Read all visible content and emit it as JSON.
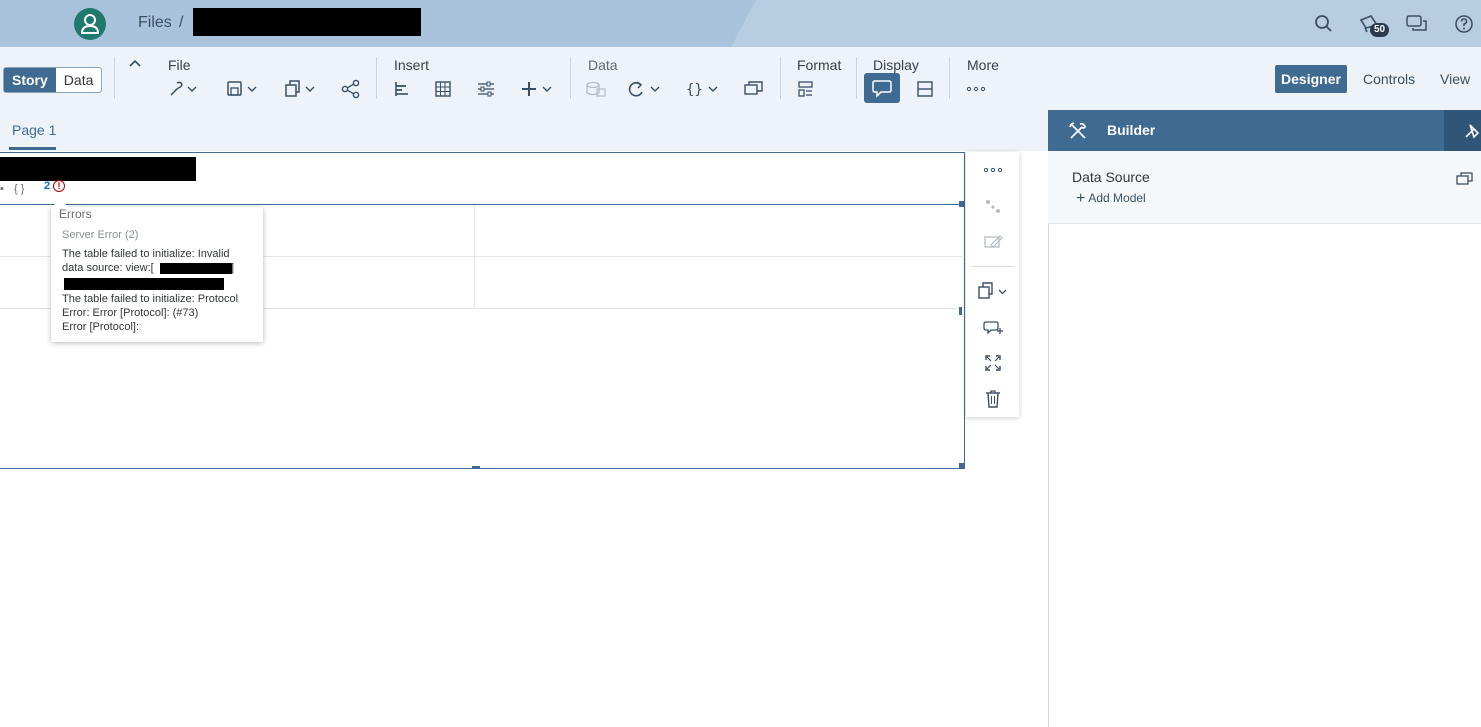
{
  "shell": {
    "breadcrumb_root": "Files",
    "breadcrumb_separator": "/",
    "notification_count": "50",
    "icons": [
      "menu-icon",
      "avatar-icon",
      "search-icon",
      "notifications-icon",
      "feedback-icon",
      "help-icon"
    ]
  },
  "toolbar": {
    "mode_tabs": {
      "story": "Story",
      "data": "Data"
    },
    "groups": {
      "file": "File",
      "insert": "Insert",
      "data": "Data",
      "format": "Format",
      "display": "Display",
      "more": "More"
    },
    "view_modes": {
      "designer": "Designer",
      "controls": "Controls",
      "view": "View"
    }
  },
  "page_tabs": {
    "page1": "Page 1"
  },
  "widget": {
    "curly_label": "{ }",
    "error_count": "2",
    "error_glyph": "!"
  },
  "error_popover": {
    "title": "Errors",
    "subtitle": "Server Error (2)",
    "line1": "The table failed to initialize: Invalid",
    "line2_prefix": "data source: view:[",
    "line2_suffix": "]",
    "line4": "The table failed to initialize: Protocol",
    "line5": "Error: Error [Protocol]: (#73)",
    "line6": "Error [Protocol]:"
  },
  "builder": {
    "title": "Builder",
    "data_source_label": "Data Source",
    "add_model_label": "Add Model"
  },
  "colors": {
    "shell_bg": "#a9c3dc",
    "toolbar_bg": "#edf3f8",
    "accent": "#3f6b93",
    "error": "#bb0000",
    "avatar": "#1f7a6d"
  }
}
